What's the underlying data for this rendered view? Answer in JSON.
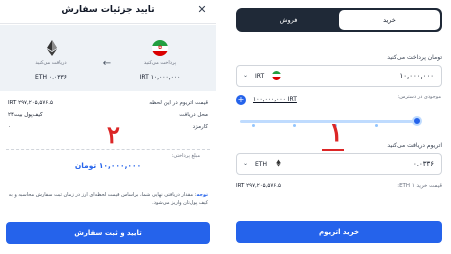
{
  "confirm_dialog": {
    "title": "تایید جزئیات سفارش",
    "close_icon": "close-icon",
    "pay_label": "پرداخت می‌کنید",
    "pay_value": "IRT ۱۰,۰۰۰,۰۰۰",
    "receive_label": "دریافت می‌کنید",
    "receive_value": "ETH ۰.۰۳۳۶",
    "arrow_icon": "arrow-left-icon",
    "rows": [
      {
        "label": "قیمت اتریوم در این لحظه",
        "value": "IRT ۲۹۷,۲۰۵,۵۷۶.۵"
      },
      {
        "label": "محل دریافت",
        "value": "کیف‌پول بیت۲۴"
      },
      {
        "label": "کارمزد",
        "value": "۰"
      }
    ],
    "annotation": "۲",
    "sum_label": "مبلغ پرداختی:",
    "sum_value": "۱۰,۰۰۰,۰۰۰ تومان",
    "note_bold": "توجه",
    "note_text": ": مقدار دریافتی نهایی شما، براساس قیمت لحظه‌ای ارز در زمان ثبت سفارش محاسبه و به کیف پول‌تان واریز می‌شود.",
    "confirm_button": "تایید و ثبت سفارش"
  },
  "trade": {
    "tab_buy": "خرید",
    "tab_sell": "فروش",
    "pay_label": "تومان پرداخت می‌کنید",
    "pay_value": "۱۰,۰۰۰,۰۰۰",
    "pay_currency": "IRT",
    "available_label": "موجودی در دسترس:",
    "available_value": "۱۰۰,۰۰۰,۰۰۰ IRT",
    "annotation": "۱",
    "receive_label": "اتریوم دریافت می‌کنید",
    "receive_value": "۰.۰۳۳۶",
    "receive_currency": "ETH",
    "rate_label": "قیمت خرید ۱ ETH:",
    "rate_value": "۲۹۷,۲۰۵,۵۷۶.۵ IRT",
    "buy_button": "خرید اتریوم"
  },
  "colors": {
    "accent": "#2563eb",
    "dark": "#1f2937",
    "annotation": "#dc2626"
  }
}
